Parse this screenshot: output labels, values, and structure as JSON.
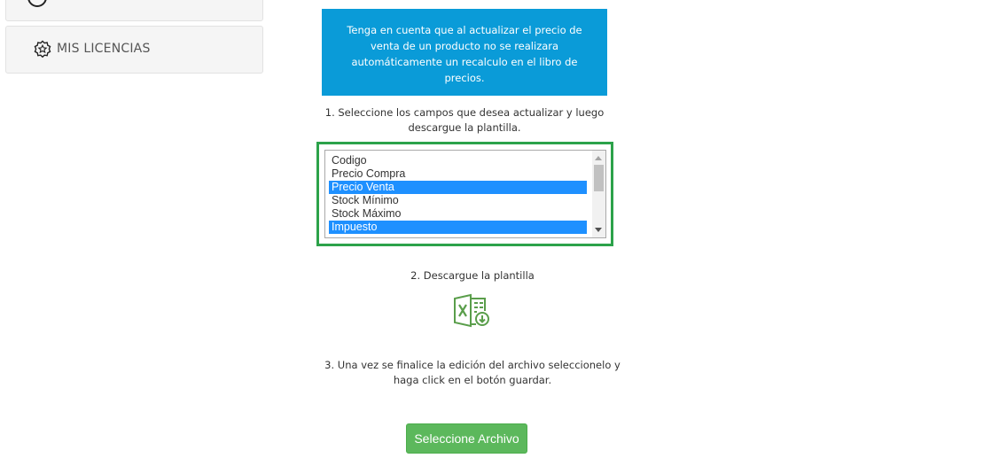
{
  "sidebar": {
    "licenses_label": "MIS LICENCIAS"
  },
  "notice": {
    "text": "Tenga en cuenta que al actualizar el precio de venta de un producto no se realizara automáticamente un recalculo en el libro de precios."
  },
  "steps": {
    "step1": "1. Seleccione los campos que desea actualizar y luego descargue la plantilla.",
    "step2": "2. Descargue la plantilla",
    "step3": "3. Una vez se finalice la edición del archivo seleccionelo y haga click en el botón guardar."
  },
  "fields_list": {
    "options": [
      {
        "label": "Codigo",
        "selected": false
      },
      {
        "label": "Precio Compra",
        "selected": false
      },
      {
        "label": "Precio Venta",
        "selected": true
      },
      {
        "label": "Stock Mínimo",
        "selected": false
      },
      {
        "label": "Stock Máximo",
        "selected": false
      },
      {
        "label": "Impuesto",
        "selected": true
      }
    ]
  },
  "upload": {
    "button_label": "Seleccione Archivo"
  },
  "colors": {
    "notice_bg": "#0a9bd8",
    "highlight_border": "#2ca24a",
    "selected_option": "#1e90ff",
    "button_green": "#5cb85c",
    "excel_icon": "#5a9e4b"
  },
  "icons": {
    "licenses": "star-badge-icon",
    "download_template": "excel-download-icon"
  }
}
